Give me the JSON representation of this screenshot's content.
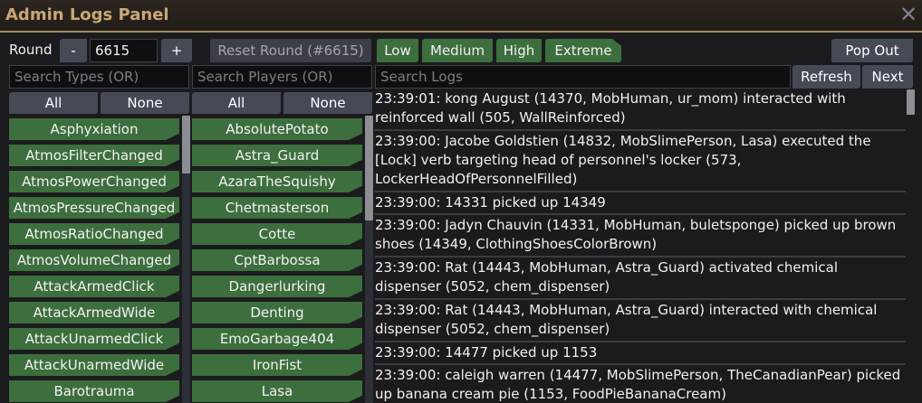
{
  "window": {
    "title": "Admin Logs Panel",
    "close_glyph": "✕"
  },
  "round": {
    "label": "Round",
    "decrement": "-",
    "value": "6615",
    "increment": "+",
    "reset_label": "Reset Round (#6615)"
  },
  "severity": [
    "Low",
    "Medium",
    "High",
    "Extreme"
  ],
  "pop_out_label": "Pop Out",
  "types": {
    "placeholder": "Search Types (OR)",
    "all_label": "All",
    "none_label": "None",
    "items": [
      "Asphyxiation",
      "AtmosFilterChanged",
      "AtmosPowerChanged",
      "AtmosPressureChanged",
      "AtmosRatioChanged",
      "AtmosVolumeChanged",
      "AttackArmedClick",
      "AttackArmedWide",
      "AttackUnarmedClick",
      "AttackUnarmedWide",
      "Barotrauma"
    ]
  },
  "players": {
    "placeholder": "Search Players (OR)",
    "all_label": "All",
    "none_label": "None",
    "items": [
      "AbsolutePotato",
      "Astra_Guard",
      "AzaraTheSquishy",
      "Chetmasterson",
      "Cotte",
      "CptBarbossa",
      "Dangerlurking",
      "Denting",
      "EmoGarbage404",
      "IronFist",
      "Lasa"
    ]
  },
  "logs": {
    "placeholder": "Search Logs",
    "refresh_label": "Refresh",
    "next_label": "Next",
    "entries": [
      "23:39:01: kong August (14370, MobHuman, ur_mom) interacted with reinforced wall (505, WallReinforced)",
      "23:39:00: Jacobe Goldstien (14832, MobSlimePerson, Lasa) executed the [Lock] verb targeting head of personnel's locker (573, LockerHeadOfPersonnelFilled)",
      "23:39:00: 14331 picked up 14349",
      "23:39:00: Jadyn Chauvin (14331, MobHuman, buletsponge) picked up brown shoes (14349, ClothingShoesColorBrown)",
      "23:39:00: Rat (14443, MobHuman, Astra_Guard) activated chemical dispenser (5052, chem_dispenser)",
      "23:39:00: Rat (14443, MobHuman, Astra_Guard) interacted with chemical dispenser (5052, chem_dispenser)",
      "23:39:00: 14477 picked up 1153",
      "23:39:00: caleigh warren (14477, MobSlimePerson, TheCanadianPear) picked up banana cream pie (1153, FoodPieBananaCream)"
    ]
  }
}
